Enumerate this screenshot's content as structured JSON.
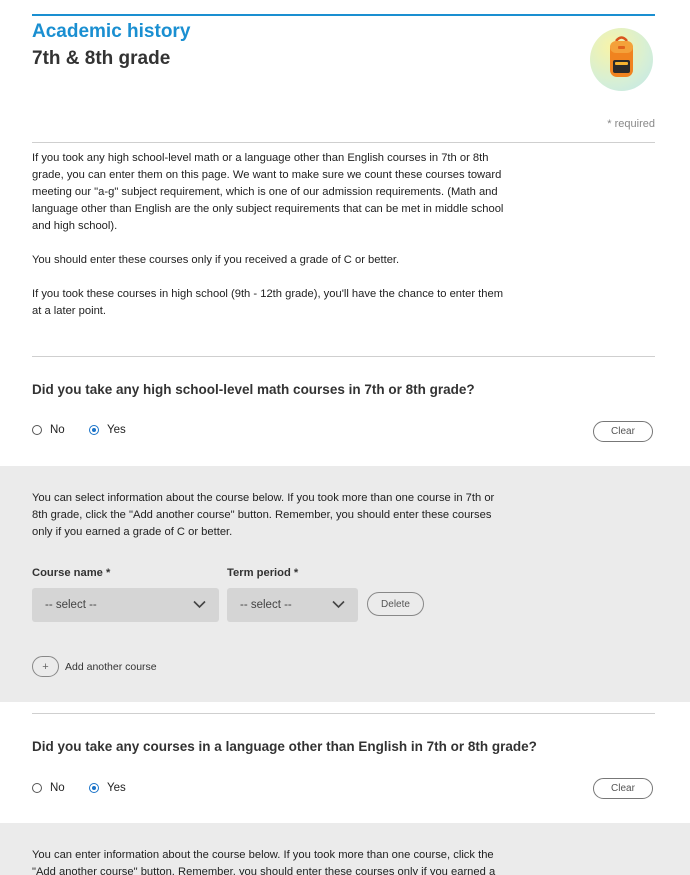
{
  "header": {
    "section_title": "Academic history",
    "page_title": "7th & 8th grade",
    "required_note": "* required",
    "badge_icon": "backpack-icon"
  },
  "intro": {
    "paragraphs": [
      "If you took any high school-level math or a language other than English courses in 7th or 8th grade, you can enter them on this page. We want to make sure we count these courses toward meeting our \"a-g\" subject requirement, which is one of our admission requirements. (Math and language other than English are the only subject requirements that can be met in middle school and high school).",
      "You should enter these courses only if you received a grade of C or better.",
      "If you took these courses in high school (9th - 12th grade), you'll have the chance to enter them at a later point."
    ]
  },
  "math": {
    "question": "Did you take any high school-level math courses in 7th or 8th grade?",
    "options": [
      "No",
      "Yes"
    ],
    "selected": "Yes",
    "clear_label": "Clear",
    "panel_text": "You can select information about the course below. If you took more than one course in 7th or 8th grade, click the \"Add another course\" button. Remember, you should enter these courses only if you earned a grade of C or better.",
    "course_label": "Course name *",
    "term_label": "Term period *",
    "course_value": "-- select --",
    "term_value": "-- select --",
    "delete_label": "Delete",
    "add_symbol": "+",
    "add_label": "Add another course"
  },
  "language": {
    "question": "Did you take any courses in a language other than English in 7th or 8th grade?",
    "options": [
      "No",
      "Yes"
    ],
    "selected": "Yes",
    "clear_label": "Clear",
    "panel_text": "You can enter information about the course below. If you took more than one course, click the \"Add another course\" button. Remember, you should enter these courses only if you earned a"
  },
  "colors": {
    "accent": "#1a8fd1",
    "panel": "#ebebeb",
    "select": "#d5d5d5",
    "radio_selected": "#1a73c8"
  }
}
